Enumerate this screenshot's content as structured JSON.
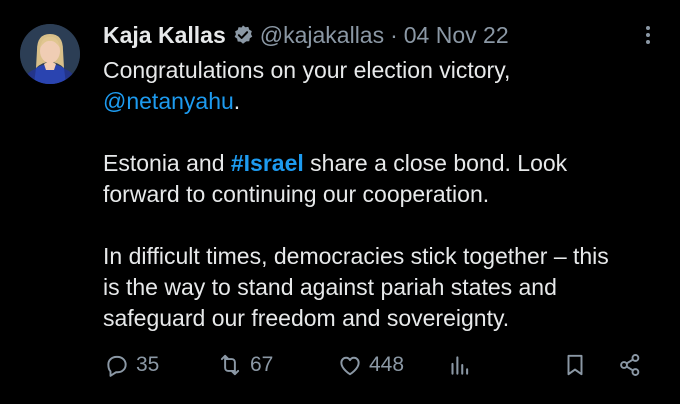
{
  "author": {
    "name": "Kaja Kallas",
    "handle": "@kajakallas",
    "separator": "·",
    "date": "04 Nov 22",
    "verified": true
  },
  "tweet": {
    "line1": "Congratulations on your election victory,",
    "mention": "@netanyahu",
    "mention_suffix": ".",
    "p2_prefix": "Estonia and ",
    "hashtag": "#Israel",
    "p2_suffix_line1": " share a close bond. Look",
    "p2_line2": "forward to continuing our cooperation.",
    "p3_line1": "In difficult times, democracies stick together – this",
    "p3_line2": "is the way to stand against pariah states and",
    "p3_line3": "safeguard our freedom and sovereignty."
  },
  "metrics": {
    "replies": "35",
    "retweets": "67",
    "likes": "448"
  },
  "icons": {
    "verified": "verified-badge-icon",
    "more": "more-vertical-icon",
    "reply": "reply-icon",
    "retweet": "retweet-icon",
    "like": "heart-icon",
    "views": "analytics-icon",
    "bookmark": "bookmark-icon",
    "share": "share-icon"
  },
  "colors": {
    "background": "#000000",
    "text": "#e7e9ea",
    "secondary": "#8b98a5",
    "accent": "#1d9bf0"
  }
}
